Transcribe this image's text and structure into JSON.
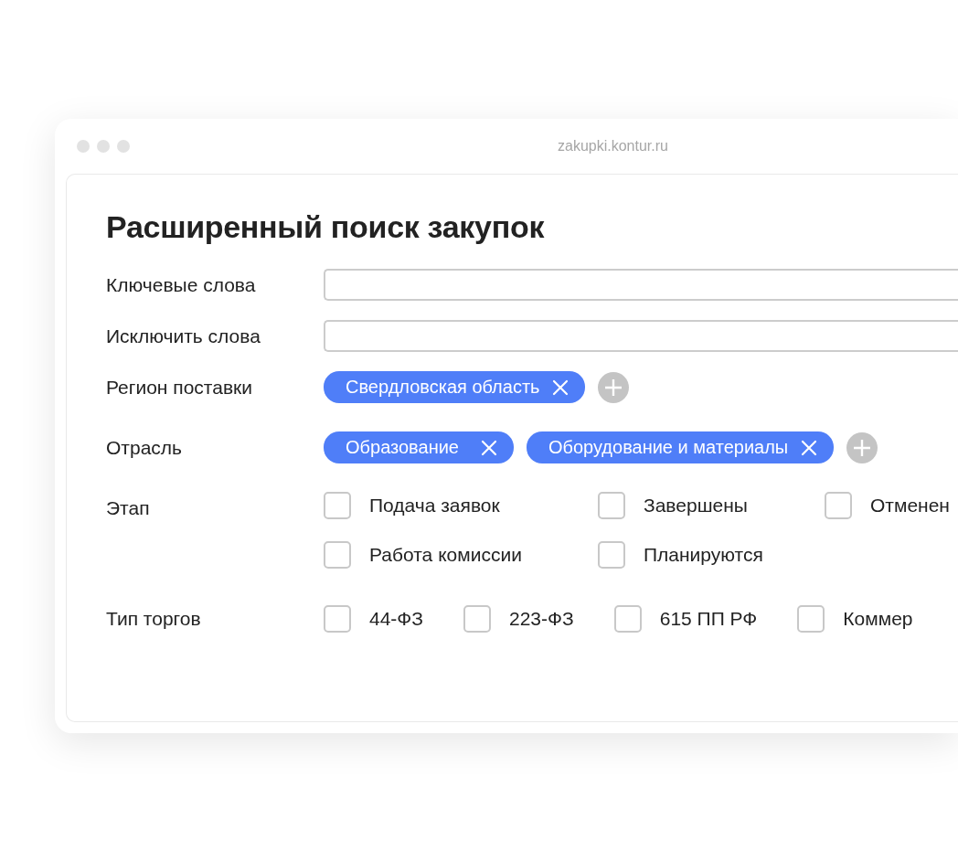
{
  "window": {
    "url": "zakupki.kontur.ru"
  },
  "heading": "Расширенный поиск закупок",
  "fields": [
    {
      "kind": "input",
      "label": "Ключевые слова"
    },
    {
      "kind": "input",
      "label": "Исключить слова"
    },
    {
      "kind": "tags",
      "label": "Регион поставки",
      "tags": [
        "Свердловская область"
      ]
    },
    {
      "kind": "tags",
      "label": "Отрасль",
      "tags": [
        "Образование",
        "Оборудование и материалы"
      ]
    },
    {
      "kind": "checkgrid",
      "label": "Этап",
      "options": [
        {
          "label": "Подача заявок",
          "checked": false
        },
        {
          "label": "Завершены",
          "checked": false
        },
        {
          "label": "Отменен",
          "checked": false
        },
        {
          "label": "Работа комиссии",
          "checked": false
        },
        {
          "label": "Планируются",
          "checked": false
        }
      ]
    },
    {
      "kind": "checkrow",
      "label": "Тип торгов",
      "options": [
        {
          "label": "44-ФЗ",
          "checked": false
        },
        {
          "label": "223-ФЗ",
          "checked": false
        },
        {
          "label": "615 ПП РФ",
          "checked": false
        },
        {
          "label": "Коммер",
          "checked": false
        }
      ]
    }
  ]
}
